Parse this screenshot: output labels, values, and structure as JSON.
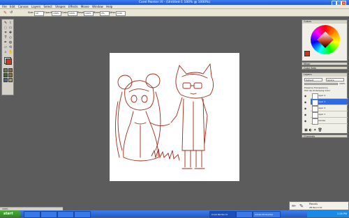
{
  "window": {
    "title": "Corel Painter IX - (Untitled-1 100% @ 1000%)",
    "title_color": "#2a5fd8"
  },
  "menu": [
    "File",
    "Edit",
    "Canvas",
    "Layers",
    "Select",
    "Shapes",
    "Effects",
    "Movie",
    "Window",
    "Help"
  ],
  "property_bar": {
    "size_label": "Size:",
    "size_value": "10",
    "opacity_label": "Opacity:",
    "opacity_value": "100%",
    "grain_label": "Grain:",
    "grain_value": "100%",
    "resat_label": "Resat:",
    "resat_value": "100%",
    "bleed_label": "Bleed:",
    "bleed_value": "0%",
    "jitter_label": "Jitter:",
    "jitter_value": "0.00"
  },
  "toolbox": {
    "tools": [
      "brush-icon",
      "dropper-icon",
      "lasso-icon",
      "rect-select-icon",
      "crop-icon",
      "text-icon",
      "shape-icon",
      "pen-icon",
      "bucket-icon",
      "eraser-icon",
      "magnifier-icon",
      "hand-icon"
    ],
    "main_color": "#d8351e",
    "secondary_color": "#ffffff"
  },
  "colors_panel": {
    "title": "Colors",
    "selected_color": "#c23a1c"
  },
  "mixer_panel": {
    "title": "Mixer"
  },
  "swatches_panel": {
    "title": "Color Sets"
  },
  "layers_panel": {
    "title": "Layers",
    "blend_mode": "Default",
    "composite": "Ignore",
    "opacity": "100%",
    "option_1": "Preserve Transparency",
    "option_2": "Pick Up Underlying Color",
    "layers": [
      {
        "name": "Layer 4",
        "selected": false
      },
      {
        "name": "Layer 3",
        "selected": true
      },
      {
        "name": "Layer 2",
        "selected": false
      },
      {
        "name": "Layer 1",
        "selected": false
      },
      {
        "name": "Canvas",
        "selected": false
      }
    ]
  },
  "channels_panel": {
    "title": "Channels"
  },
  "navigator": {
    "label": "Pencils",
    "sub": "2B Pencil 10"
  },
  "status": {
    "zoom": "100%"
  },
  "taskbar": {
    "start": "start",
    "tasks": [
      "",
      "",
      "",
      "",
      "Corel Painter IX",
      "",
      "Adobe Photoshop"
    ],
    "clock": "1:28 PM"
  },
  "drawing": {
    "line_color": "#9b2a16"
  }
}
